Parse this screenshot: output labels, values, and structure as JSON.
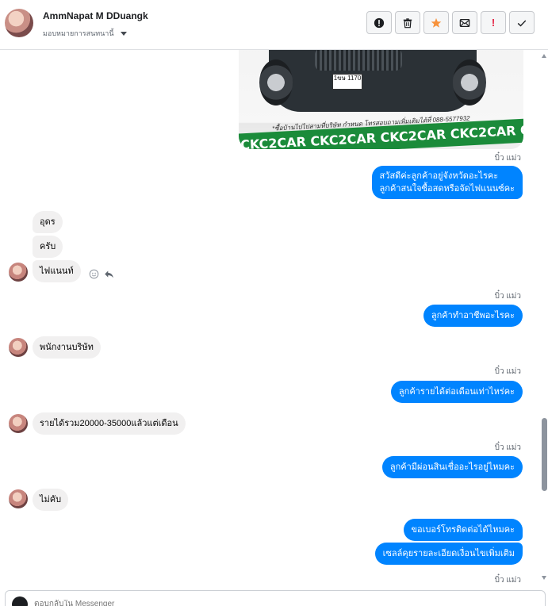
{
  "header": {
    "contact_name": "AmmNapat M DDuangk",
    "assign_label": "มอบหมายการสนทนานี้",
    "toolbar": {
      "actions": [
        "alert-circle-icon",
        "trash-icon",
        "star-icon",
        "mark-unread-icon",
        "priority-icon",
        "check-icon"
      ],
      "priority_label": "!"
    },
    "colors": {
      "star": "#f7923b",
      "priority": "#e41e3f"
    }
  },
  "conversation": {
    "car_image": {
      "plate": "1ขษ 1170",
      "caption": "*ซื้อบ้านไปไปสามที่บริษัท กำหนด โทรสอบถามเพิ่มเติมได้ที่ 088-5577932",
      "banner": "CKC2CAR CKC2CAR CKC2CAR CKC2CAR CKC2"
    },
    "messages": [
      {
        "dir": "out",
        "sender": "บิ๋ว แม่ว",
        "lines": [
          "สวัสดีค่ะลูกค้าอยู่จังหวัดอะไรคะ",
          "ลูกค้าสนใจซื้อสดหรือจัดไฟแนนซ์คะ"
        ]
      },
      {
        "dir": "in",
        "text": "อุดร"
      },
      {
        "dir": "in",
        "text": "ครับ"
      },
      {
        "dir": "in",
        "text": "ไฟแนนท์"
      },
      {
        "dir": "out",
        "sender": "บิ๋ว แม่ว",
        "text": "ลูกค้าทำอาชีพอะไรคะ"
      },
      {
        "dir": "in",
        "text": "พนักงานบริษัท"
      },
      {
        "dir": "out",
        "sender": "บิ๋ว แม่ว",
        "text": "ลูกค้ารายได้ต่อเดือนเท่าไหร่คะ"
      },
      {
        "dir": "in",
        "text": "รายได้รวม20000-35000แล้วแต่เดือน"
      },
      {
        "dir": "out",
        "sender": "บิ๋ว แม่ว",
        "text": "ลูกค้ามีผ่อนสินเชื่ออะไรอยู่ไหมคะ"
      },
      {
        "dir": "in",
        "text": "ไม่คับ"
      },
      {
        "dir": "out",
        "text": "ขอเบอร์โทรติดต่อได้ไหมคะ"
      },
      {
        "dir": "out",
        "text": "เซลล์คุยรายละเอียดเงื่อนไขเพิ่มเติม"
      },
      {
        "dir": "out_sender_only",
        "sender": "บิ๋ว แม่ว"
      }
    ],
    "bubble_color": "#0084ff"
  },
  "composer": {
    "placeholder": "ตอบกลับใน Messenger"
  }
}
